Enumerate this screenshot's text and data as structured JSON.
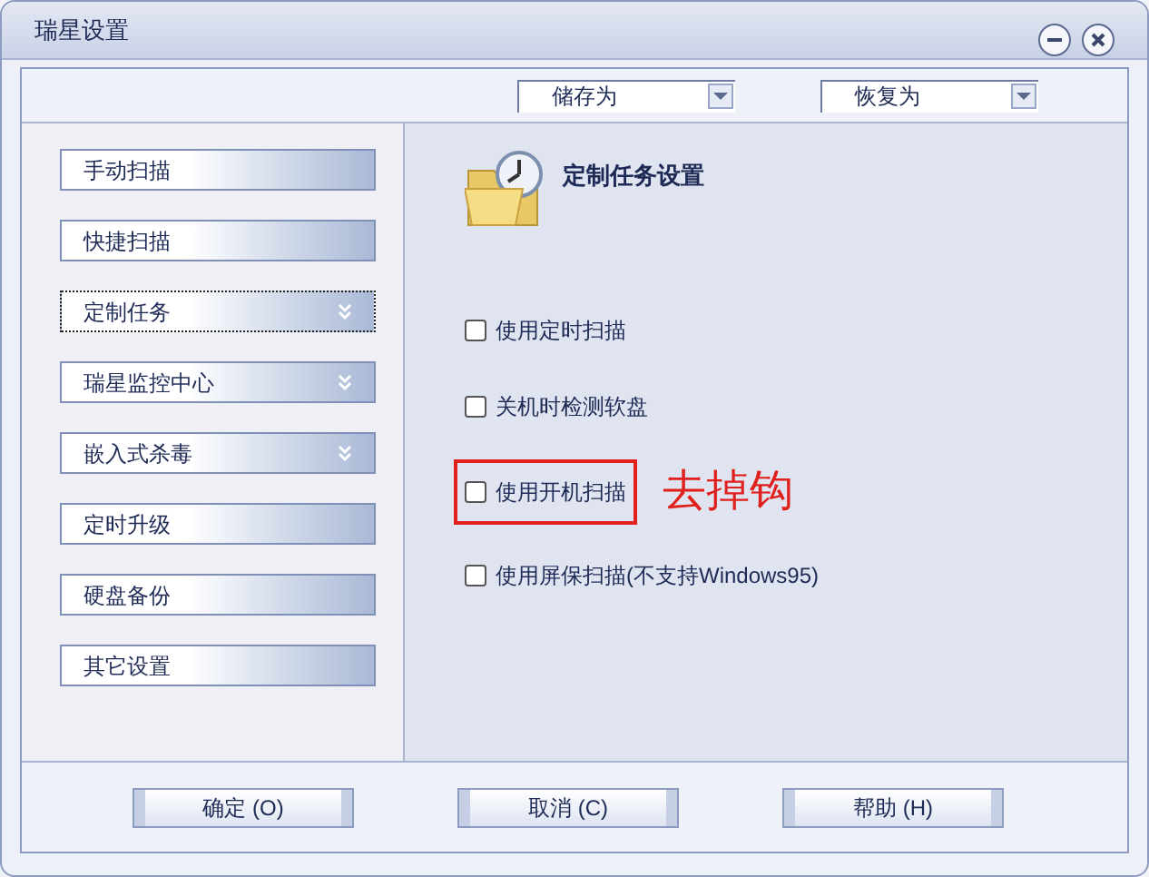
{
  "window": {
    "title": "瑞星设置"
  },
  "toolbar": {
    "dropdowns": [
      {
        "value": "储存为"
      },
      {
        "value": "恢复为"
      }
    ]
  },
  "sidebar": {
    "items": [
      {
        "label": "手动扫描",
        "kind": "plain",
        "selected": false
      },
      {
        "label": "快捷扫描",
        "kind": "plain",
        "selected": false
      },
      {
        "label": "定制任务",
        "kind": "expandable",
        "selected": true
      },
      {
        "label": "瑞星监控中心",
        "kind": "expandable",
        "selected": false
      },
      {
        "label": "嵌入式杀毒",
        "kind": "expandable",
        "selected": false
      },
      {
        "label": "定时升级",
        "kind": "plain",
        "selected": false
      },
      {
        "label": "硬盘备份",
        "kind": "plain",
        "selected": false
      },
      {
        "label": "其它设置",
        "kind": "plain",
        "selected": false
      }
    ]
  },
  "content": {
    "heading": "定制任务设置",
    "options": [
      {
        "label": "使用定时扫描",
        "checked": false,
        "highlighted": false
      },
      {
        "label": "关机时检测软盘",
        "checked": false,
        "highlighted": false
      },
      {
        "label": "使用开机扫描",
        "checked": false,
        "highlighted": true,
        "annotation": "去掉钩"
      },
      {
        "label": "使用屏保扫描(不支持Windows95)",
        "checked": false,
        "highlighted": false
      }
    ]
  },
  "buttons": [
    "确定 (O)",
    "取消 (C)",
    "帮助 (H)"
  ]
}
